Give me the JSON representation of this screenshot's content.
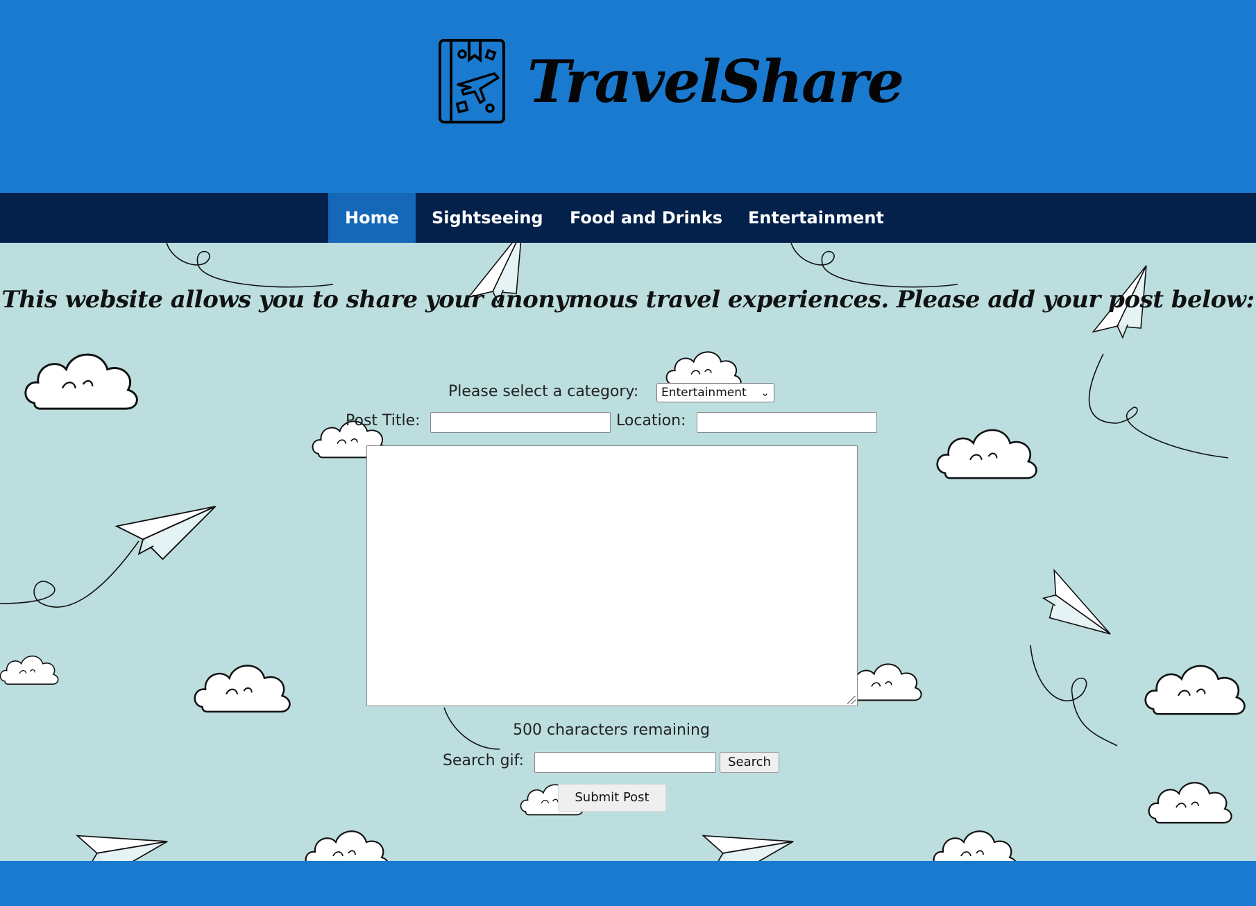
{
  "brand": {
    "name": "TravelShare",
    "logo_icon": "travel-passport-icon"
  },
  "nav": {
    "items": [
      {
        "label": "Home",
        "active": true
      },
      {
        "label": "Sightseeing",
        "active": false
      },
      {
        "label": "Food and Drinks",
        "active": false
      },
      {
        "label": "Entertainment",
        "active": false
      }
    ]
  },
  "main": {
    "intro": "This website allows you to share your anonymous travel experiences. Please add your post below:",
    "form": {
      "category_label": "Please select a category:",
      "category_selected": "Entertainment",
      "post_title_label": "Post Title:",
      "post_title_value": "",
      "location_label": "Location:",
      "location_value": "",
      "body_value": "",
      "counter_text": "500 characters remaining",
      "search_gif_label": "Search gif:",
      "search_gif_value": "",
      "search_button": "Search",
      "submit_button": "Submit Post"
    }
  },
  "colors": {
    "header_bg": "#1a7ad0",
    "nav_bg": "#03214a",
    "nav_active_bg": "#1468b7",
    "content_bg": "#bcdedf",
    "footer_bg": "#1a7ad0"
  }
}
